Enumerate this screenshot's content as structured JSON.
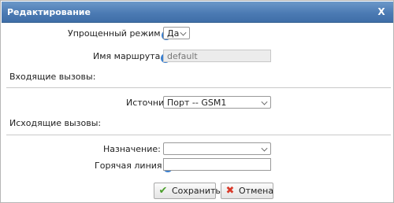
{
  "dialog": {
    "title": "Редактирование",
    "close_label": "X"
  },
  "form": {
    "simplified_mode": {
      "label": "Упрощенный режим",
      "value": "Да"
    },
    "route_name": {
      "label": "Имя маршрута",
      "value": "default"
    },
    "incoming_section": "Входящие вызовы:",
    "source": {
      "label": "Источник",
      "value": "Порт -- GSM1"
    },
    "outgoing_section": "Исходящие вызовы:",
    "destination": {
      "label": "Назначение:",
      "value": ""
    },
    "hotline": {
      "label": "Горячая линия",
      "value": ""
    }
  },
  "buttons": {
    "save_label": "Сохранить",
    "cancel_label": "Отмена"
  },
  "icons": {
    "info": "info-icon",
    "save": "checkmark-icon",
    "cancel": "x-icon"
  }
}
